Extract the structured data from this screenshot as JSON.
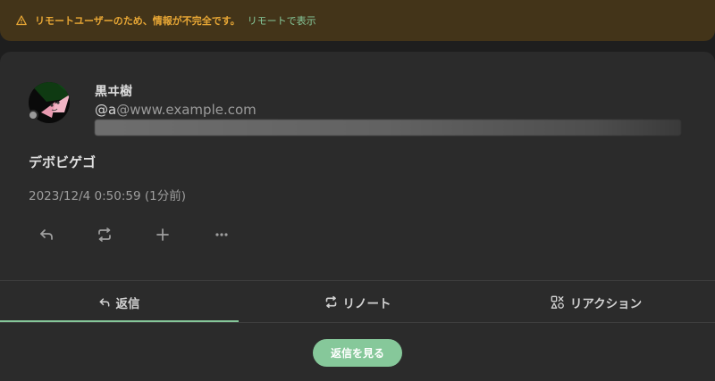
{
  "banner": {
    "warning_text": "リモートユーザーのため、情報が不完全です。",
    "remote_link": "リモートで表示"
  },
  "note": {
    "author": {
      "display_name": "黒ヰ樹",
      "username": "@a",
      "host": "@www.example.com"
    },
    "text": "デボビゲゴ",
    "timestamp": "2023/12/4 0:50:59 (1分前)"
  },
  "actions": {
    "icons": [
      "reply-icon",
      "renote-icon",
      "plus-icon",
      "more-icon"
    ]
  },
  "tabs": [
    {
      "label": "返信",
      "icon": "reply-icon",
      "active": true
    },
    {
      "label": "リノート",
      "icon": "renote-icon",
      "active": false
    },
    {
      "label": "リアクション",
      "icon": "reaction-icon",
      "active": false
    }
  ],
  "view_replies_button": "返信を見る",
  "colors": {
    "accent": "#86c89a",
    "warning": "#e8a735",
    "banner_bg": "#433419",
    "card_bg": "#2b2b2b",
    "page_bg": "#1e1e1e"
  }
}
